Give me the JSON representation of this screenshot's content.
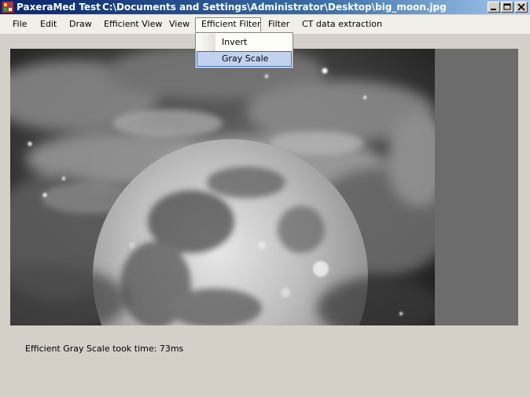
{
  "window": {
    "app_name": "PaxeraMed Test",
    "file_path": "C:\\Documents and Settings\\Administrator\\Desktop\\big_moon.jpg"
  },
  "menu": {
    "items": [
      {
        "label": "File"
      },
      {
        "label": "Edit"
      },
      {
        "label": "Draw"
      },
      {
        "label": "Efficient View"
      },
      {
        "label": "View"
      },
      {
        "label": "Efficient Filter"
      },
      {
        "label": "Filter"
      },
      {
        "label": "CT data extraction"
      }
    ],
    "open_index": 5
  },
  "dropdown": {
    "items": [
      {
        "label": "Invert"
      },
      {
        "label": "Gray Scale"
      }
    ],
    "highlighted_index": 1
  },
  "image": {
    "subject": "grayscale moon among clouds and stars"
  },
  "status": {
    "text": "Efficient Gray Scale took time: 73ms"
  },
  "colors": {
    "titlebar": "#0a246a",
    "menu_bg": "#f1efe9",
    "highlight": "#c1d2ee",
    "highlight_border": "#316ac5",
    "window_bg": "#d4d0c8",
    "canvas_bg": "#6c6c6c"
  }
}
